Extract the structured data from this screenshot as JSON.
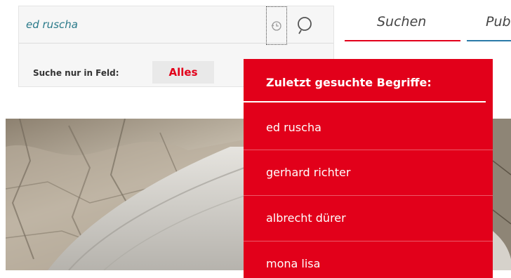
{
  "search": {
    "value": "ed ruscha",
    "field_label": "Suche nur in Feld:",
    "field_value": "Alles"
  },
  "tabs": [
    {
      "label": "Suchen"
    },
    {
      "label": "Pub"
    }
  ],
  "dropdown": {
    "header": "Zuletzt gesuchte Begriffe:",
    "items": [
      {
        "label": "ed ruscha"
      },
      {
        "label": "gerhard richter"
      },
      {
        "label": "albrecht dürer"
      },
      {
        "label": "mona lisa"
      }
    ]
  },
  "colors": {
    "accent": "#e2001a",
    "tab_active_underline": "#e2001a",
    "tab_other_underline": "#2a7aa8",
    "input_text": "#2a7a8a"
  },
  "icons": {
    "history": "history-clock-icon",
    "search": "search-icon"
  }
}
